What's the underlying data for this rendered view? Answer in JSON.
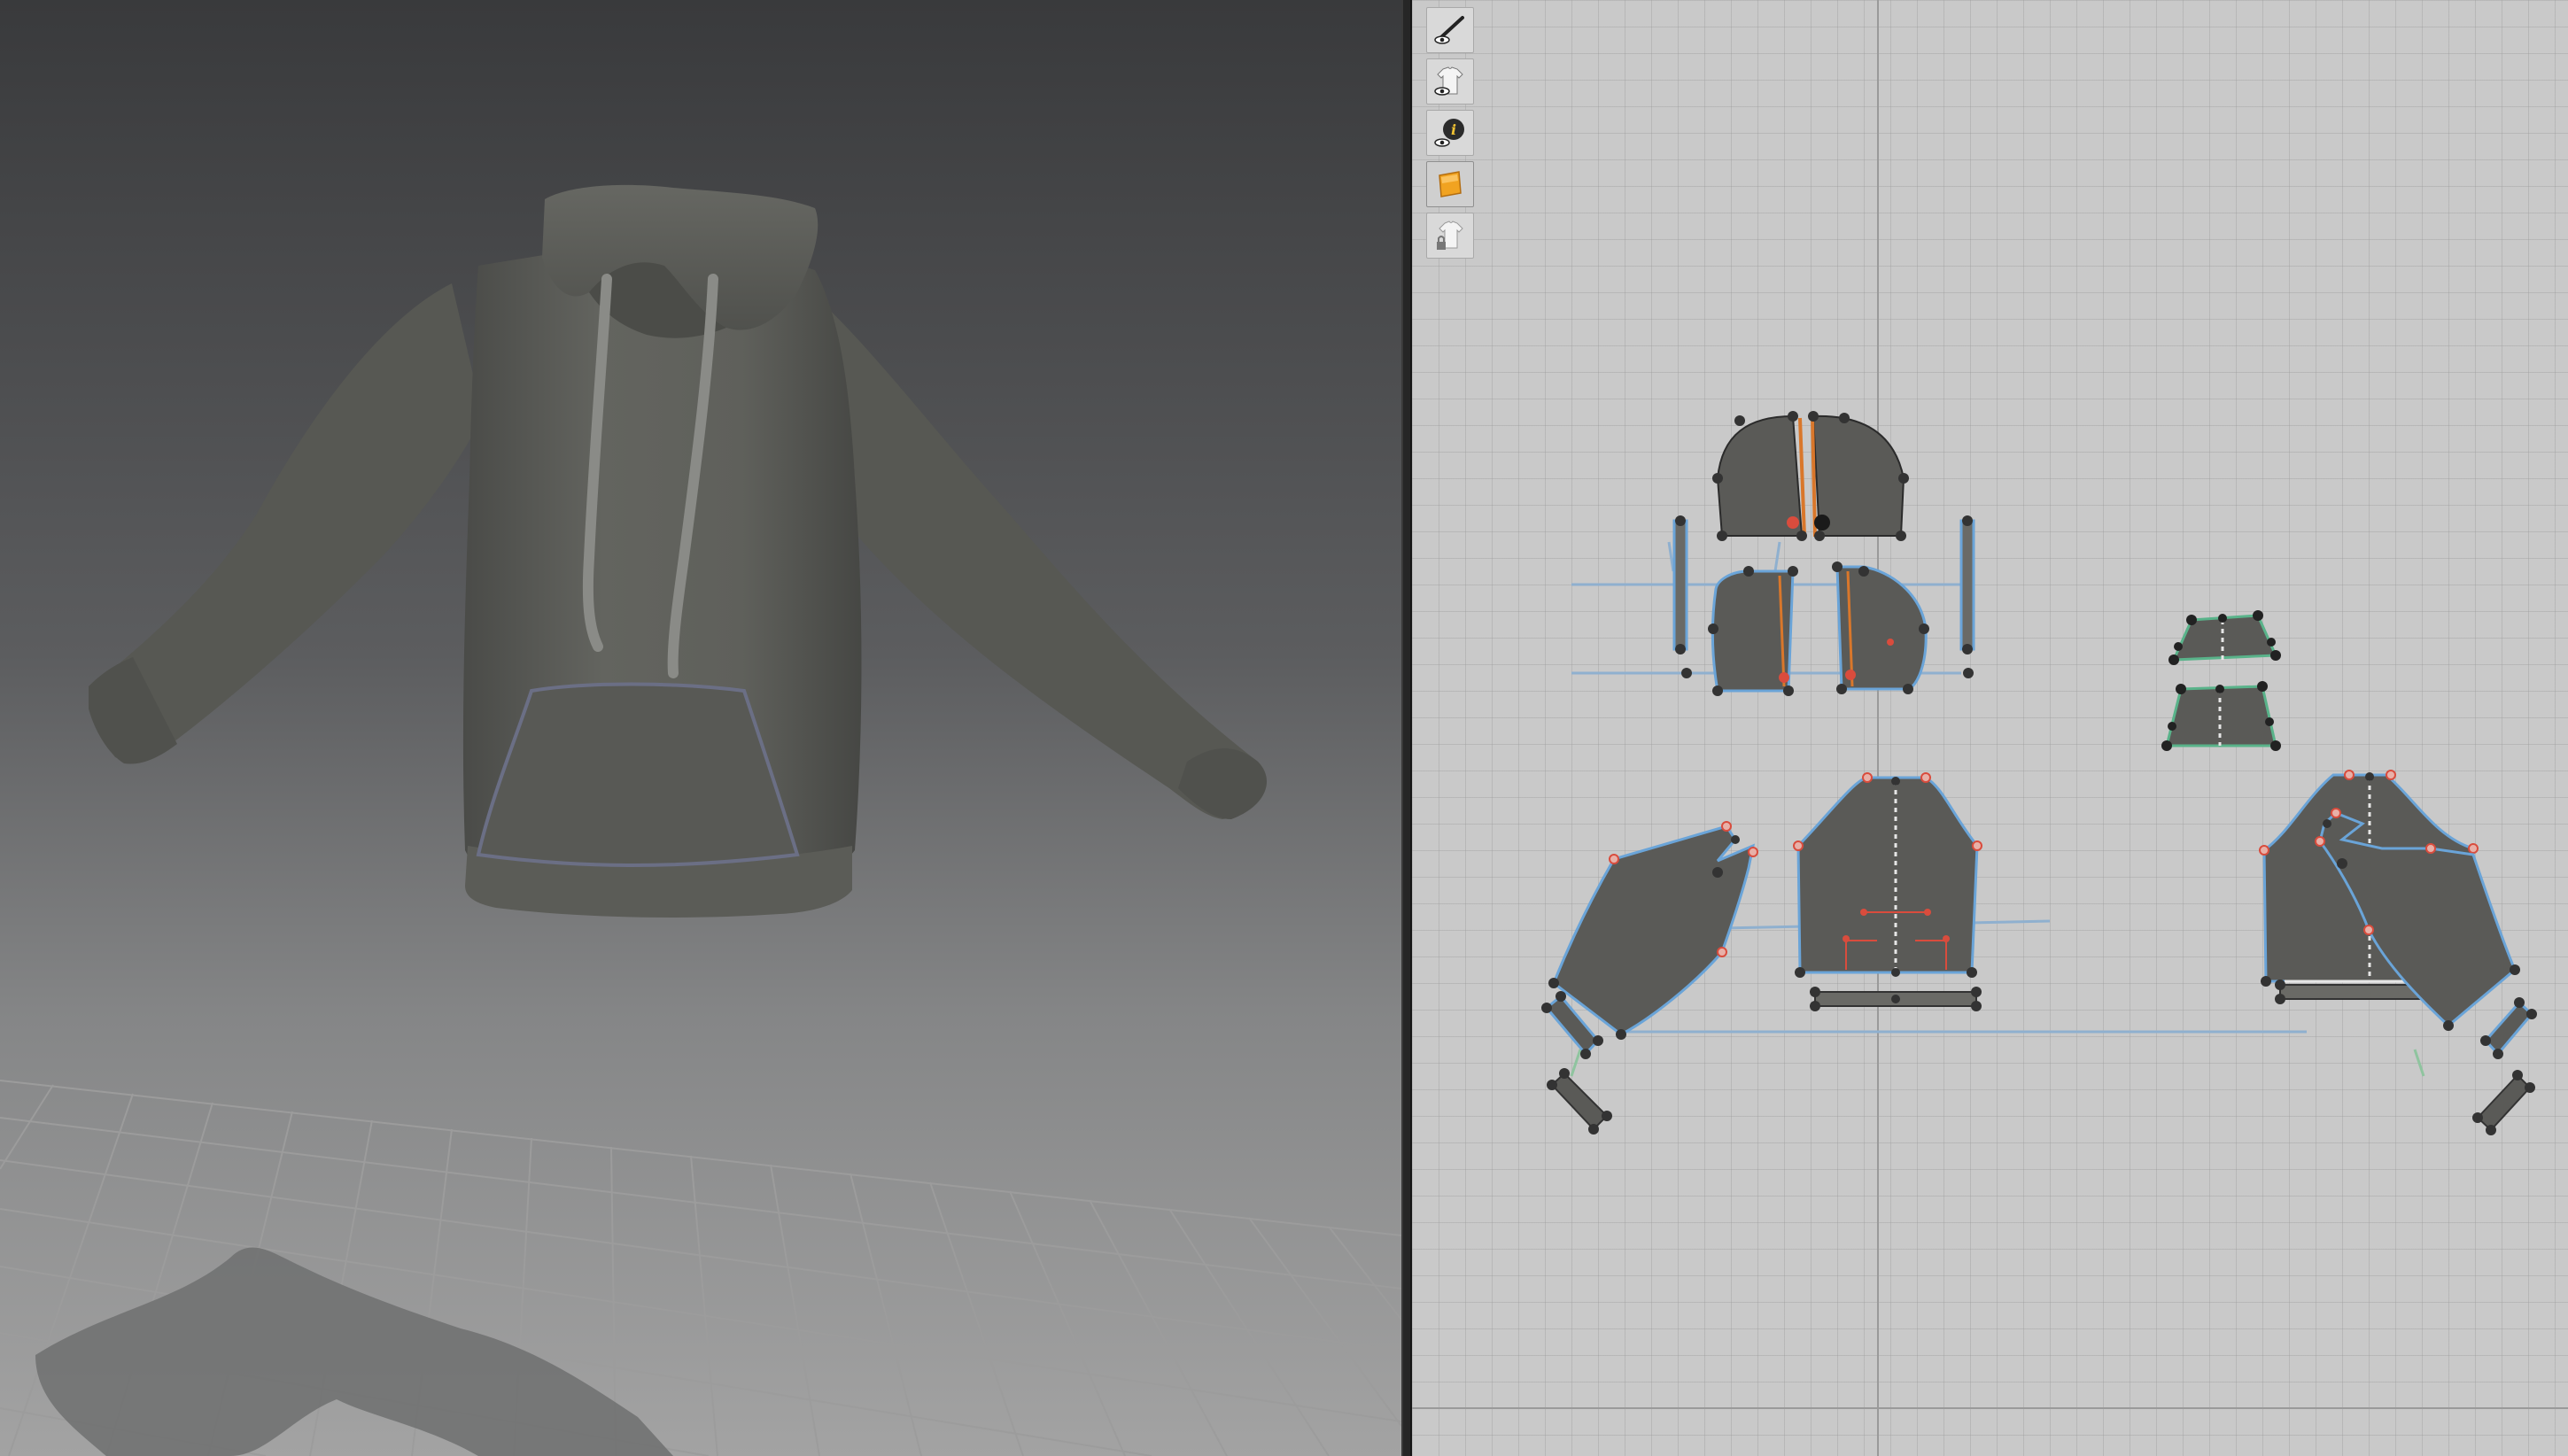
{
  "window": {
    "left_view": "3d-garment-view",
    "right_view": "2d-pattern-view"
  },
  "colors": {
    "garment": "#5c5d5a",
    "pattern_fill": "#5a5a57",
    "outline": "#78a9d6",
    "point_red": "#d94c3d",
    "grid_2d_bg": "#c9c9c9",
    "accent_orange": "#f1a321"
  },
  "toolbar_2d": {
    "buttons": [
      {
        "icon": "eye-brush-icon",
        "label": ""
      },
      {
        "icon": "eye-garment-icon",
        "label": ""
      },
      {
        "icon": "eye-info-icon",
        "label": ""
      },
      {
        "icon": "fabric-texture-icon",
        "label": ""
      },
      {
        "icon": "lock-garment-icon",
        "label": ""
      }
    ]
  }
}
